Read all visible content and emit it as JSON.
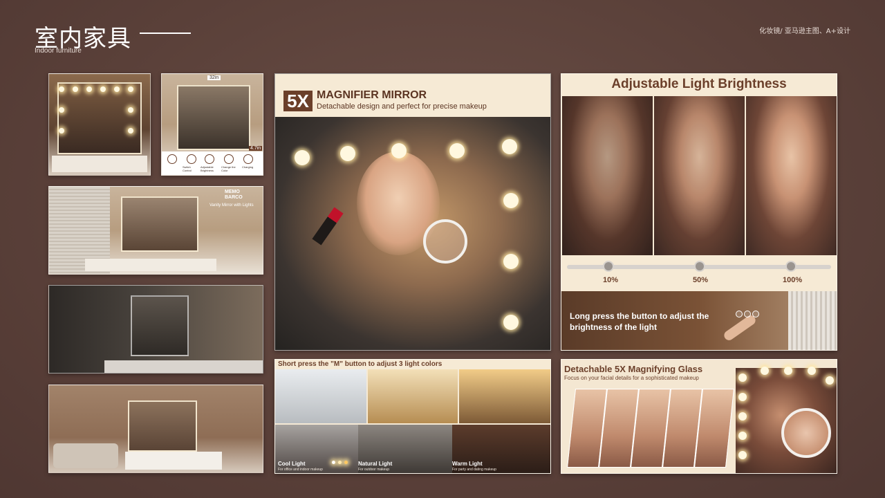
{
  "header": {
    "title": "室内家具",
    "subtitle": "Indoor furniture",
    "top_right": "化妆镜/ 亚马逊主图、A+设计"
  },
  "thumb2": {
    "size_top": "32in",
    "size_side": "4.7in",
    "icons": [
      "Switch Control",
      "Adjustable Brightness",
      "Change the Color",
      "Charging"
    ]
  },
  "thumb3": {
    "brand_line1": "MEMO",
    "brand_line2": "BARCO",
    "caption": "Vanity Mirror with Lights"
  },
  "magnifier": {
    "badge": "5X",
    "title": "MAGNIFIER MIRROR",
    "subtitle": "Detachable design and perfect for precise makeup"
  },
  "brightness": {
    "title": "Adjustable Light Brightness",
    "levels": [
      "10%",
      "50%",
      "100%"
    ],
    "level_values": [
      10,
      50,
      100
    ],
    "press_text": "Long press the button to adjust the brightness of the light"
  },
  "light_colors": {
    "header": "Short press the \"M\" button to adjust 3 light colors",
    "modes": [
      {
        "name": "Cool Light",
        "desc": "For office and indoor makeup"
      },
      {
        "name": "Natural Light",
        "desc": "For outdoor makeup"
      },
      {
        "name": "Warm Light",
        "desc": "For party and dating makeup"
      }
    ]
  },
  "glass": {
    "title": "Detachable 5X Magnifying Glass",
    "subtitle": "Focus on your facial details for a sophisticated makeup"
  }
}
